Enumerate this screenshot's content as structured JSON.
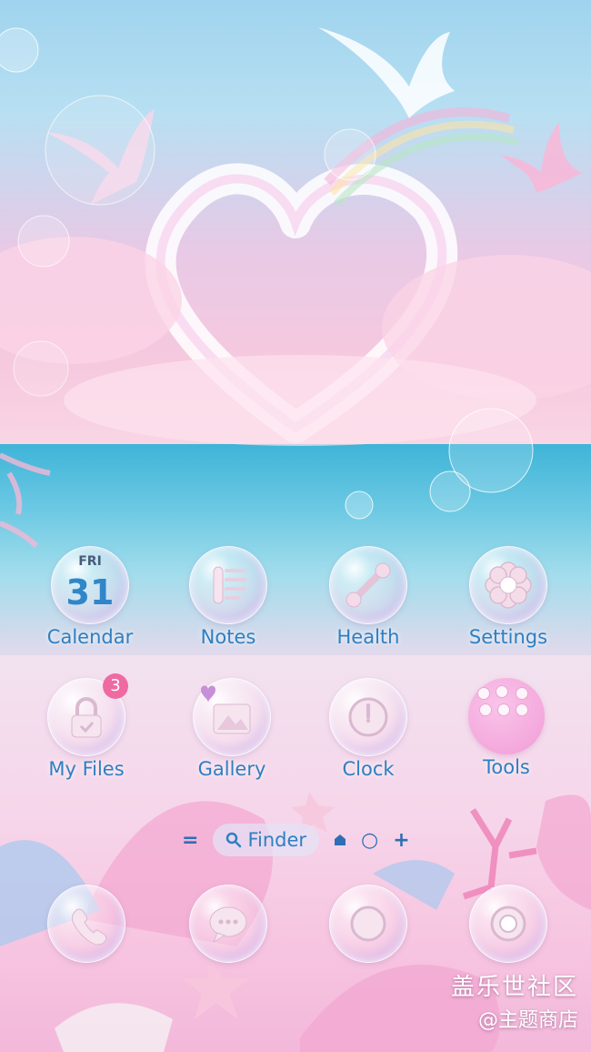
{
  "home_screen": {
    "apps": [
      {
        "label": "Calendar",
        "icon": "calendar-icon",
        "day": "FRI",
        "date": "31"
      },
      {
        "label": "Notes",
        "icon": "notes-icon"
      },
      {
        "label": "Health",
        "icon": "health-icon"
      },
      {
        "label": "Settings",
        "icon": "gear-icon"
      },
      {
        "label": "My Files",
        "icon": "folder-lock-icon",
        "badge": "3"
      },
      {
        "label": "Gallery",
        "icon": "gallery-icon"
      },
      {
        "label": "Clock",
        "icon": "clock-icon"
      },
      {
        "label": "Tools",
        "icon": "tools-folder-icon"
      }
    ],
    "page_bar": {
      "menu_icon": "=",
      "finder_label": "Finder",
      "home_icon": "home-icon",
      "circle_icon": "○",
      "add_icon": "+"
    },
    "dock": [
      {
        "icon": "phone-icon"
      },
      {
        "icon": "messages-icon"
      },
      {
        "icon": "internet-icon"
      },
      {
        "icon": "camera-icon"
      }
    ]
  },
  "watermark": {
    "line1": "盖乐世社区",
    "line2": "@主题商店"
  },
  "colors": {
    "label": "#2f7fc1",
    "badge": "#f06aa2",
    "tools": "#f4a8dc"
  }
}
